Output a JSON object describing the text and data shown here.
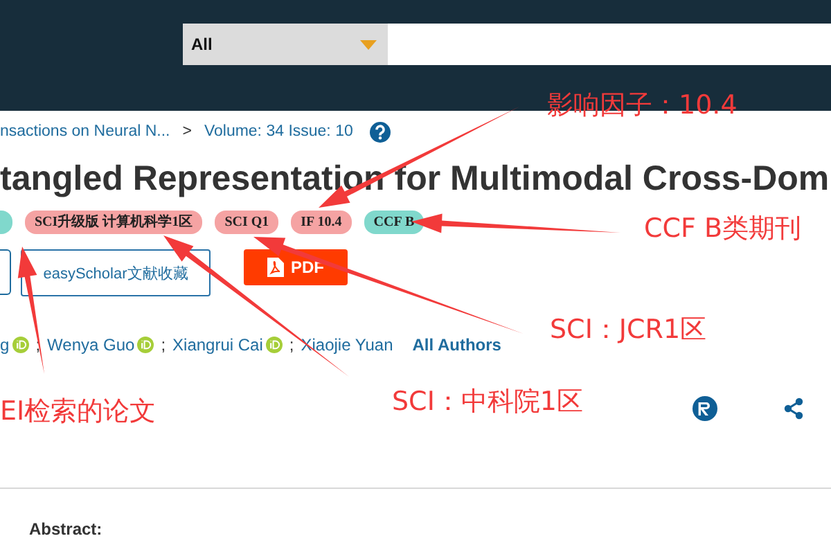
{
  "search": {
    "scope": "All"
  },
  "breadcrumb": [
    {
      "text": "nsactions on Neural N..."
    },
    {
      "text": ">"
    },
    {
      "text": "Volume: 34 Issue: 10"
    }
  ],
  "title": "tangled Representation for Multimodal Cross-Dom",
  "tags": [
    {
      "color": "#80d8cc"
    },
    {
      "text": "SCI升级版 计算机科学1区",
      "color": "#f5a3a3"
    },
    {
      "text": "SCI Q1",
      "color": "#f5a3a3"
    },
    {
      "text": "IF 10.4",
      "color": "#f5a3a3"
    },
    {
      "text": "CCF B",
      "color": "#80d8cc"
    }
  ],
  "buttons": [
    {
      "label": "easyScholar文献收藏",
      "kind": "outline"
    },
    {
      "label": "PDF",
      "kind": "pdf"
    }
  ],
  "authors": [
    {
      "name": "g",
      "orcid": true,
      "separator": ";"
    },
    {
      "name": "Wenya Guo",
      "orcid": true,
      "separator": ";"
    },
    {
      "name": "Xiangrui Cai",
      "orcid": true,
      "separator": ";"
    },
    {
      "name": "Xiaojie Yuan",
      "orcid": false
    }
  ],
  "all_authors": "All Authors",
  "abstract_heading": "Abstract:",
  "annotations": [
    {
      "text": "影响因子：10.4"
    },
    {
      "text": "CCF B类期刊"
    },
    {
      "text": "SCI：JCR1区"
    },
    {
      "text": "EI检索的论文"
    },
    {
      "text": "SCI：中科院1区"
    }
  ]
}
